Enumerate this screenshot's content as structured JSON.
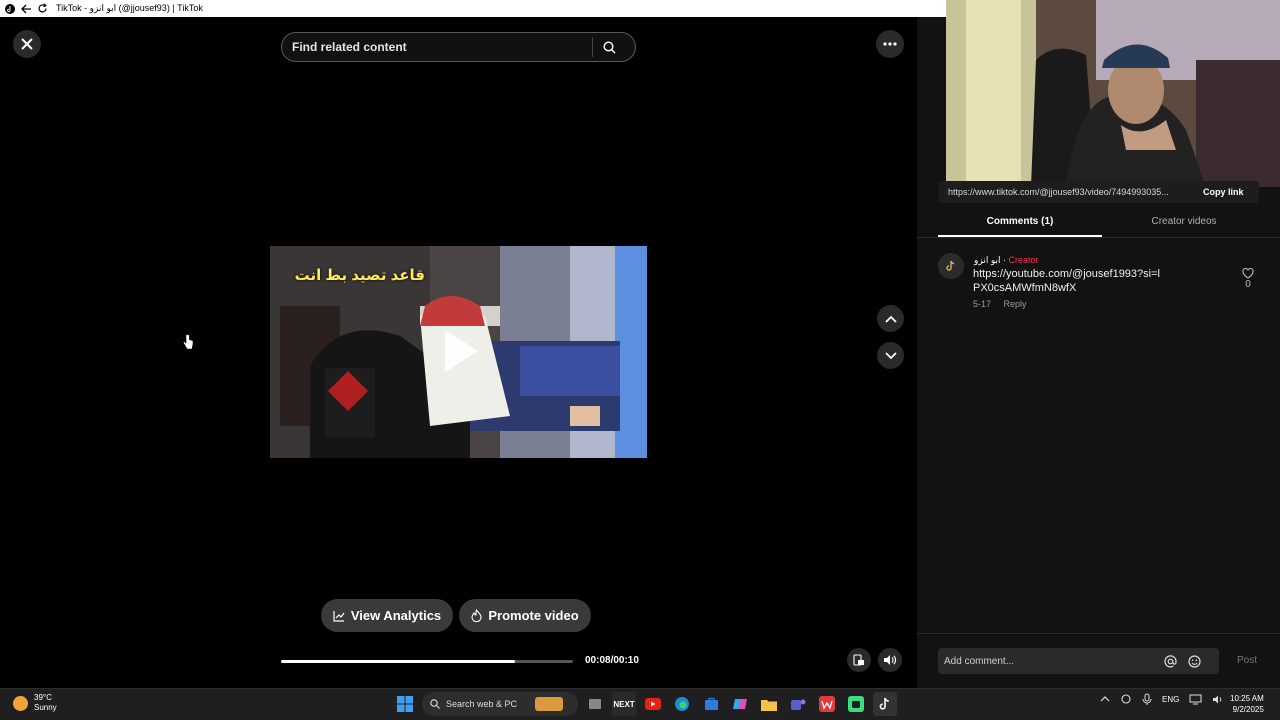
{
  "window": {
    "title": "TikTok - ابو انزو (@jjousef93) | TikTok"
  },
  "search": {
    "placeholder": "Find related content"
  },
  "video": {
    "caption": "قاعد تصيد بط انت",
    "elapsed": "00:08",
    "duration": "00:10",
    "time_label": "00:08/00:10",
    "progress": 0.8
  },
  "actions": {
    "analytics_label": "View Analytics",
    "promote_label": "Promote video"
  },
  "panel": {
    "link_url": "https://www.tiktok.com/@jjousef93/video/7494993035...",
    "copy_label": "Copy link",
    "tabs": [
      {
        "label": "Comments (1)",
        "active": true
      },
      {
        "label": "Creator videos",
        "active": false
      }
    ],
    "comments": [
      {
        "author": "ابو انزو",
        "separator": "·",
        "badge": "Creator",
        "text": "https://youtube.com/@jousef1993?si=lPX0csAMWfmN8wfX",
        "date": "5-17",
        "reply": "Reply",
        "likes": "0"
      }
    ],
    "compose_placeholder": "Add comment...",
    "post_label": "Post"
  },
  "taskbar": {
    "weather_temp": "39°C",
    "weather_desc": "Sunny",
    "search_label": "Search web & PC",
    "next_label": "NEXT",
    "tray_lang": "ENG",
    "time": "10:25 AM",
    "date": "9/2/2025"
  },
  "colors": {
    "accent": "#fe2c55",
    "panel": "#121212",
    "pill": "#3a3a3a"
  }
}
